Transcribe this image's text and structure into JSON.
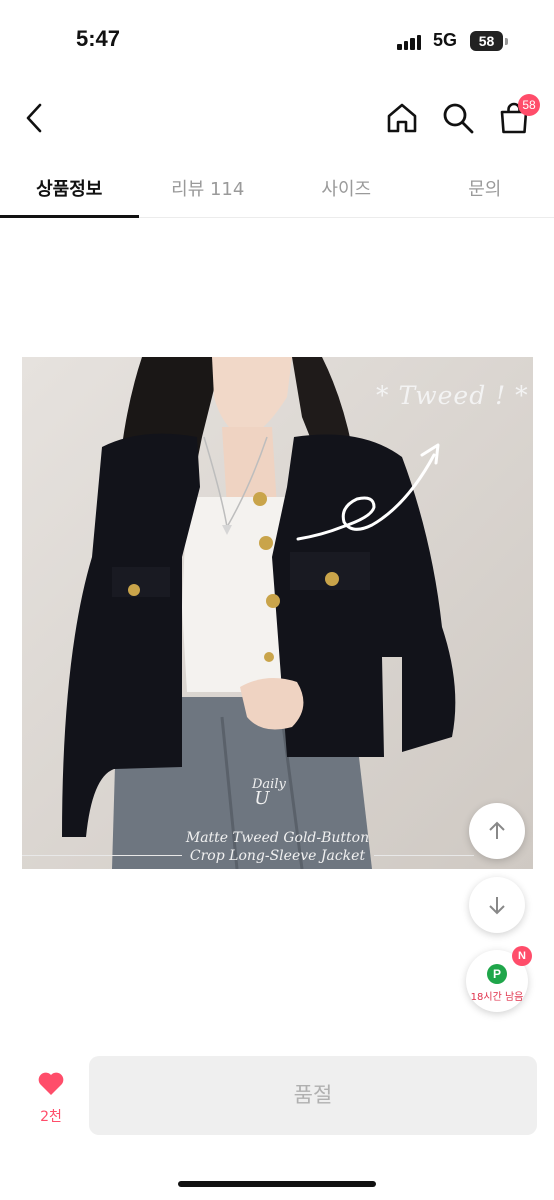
{
  "status_bar": {
    "time": "5:47",
    "network": "5G",
    "battery": "58"
  },
  "header": {
    "back_icon": "chevron-left-icon",
    "home_icon": "home-icon",
    "search_icon": "search-icon",
    "cart_icon": "shopping-bag-icon",
    "cart_count": "58"
  },
  "tabs": [
    {
      "label": "상품정보",
      "active": true
    },
    {
      "label": "리뷰 114",
      "active": false
    },
    {
      "label": "사이즈",
      "active": false
    },
    {
      "label": "문의",
      "active": false
    }
  ],
  "product_image": {
    "overlay_text": "* Tweed ! *",
    "brand_top": "Daily",
    "brand_bottom": "U",
    "caption_line1": "Matte Tweed Gold-Button",
    "caption_line2": "Crop Long-Sleeve Jacket"
  },
  "floating": {
    "scroll_up_icon": "arrow-up-icon",
    "scroll_down_icon": "arrow-down-icon",
    "points_icon_label": "P",
    "points_text": "18시간 남음",
    "points_badge": "N"
  },
  "bottom_bar": {
    "like_icon": "heart-icon",
    "like_count": "2천",
    "buy_button_label": "품절"
  },
  "colors": {
    "accent": "#ff4d6a",
    "points_green": "#1fa64a",
    "disabled_bg": "#efefef"
  }
}
